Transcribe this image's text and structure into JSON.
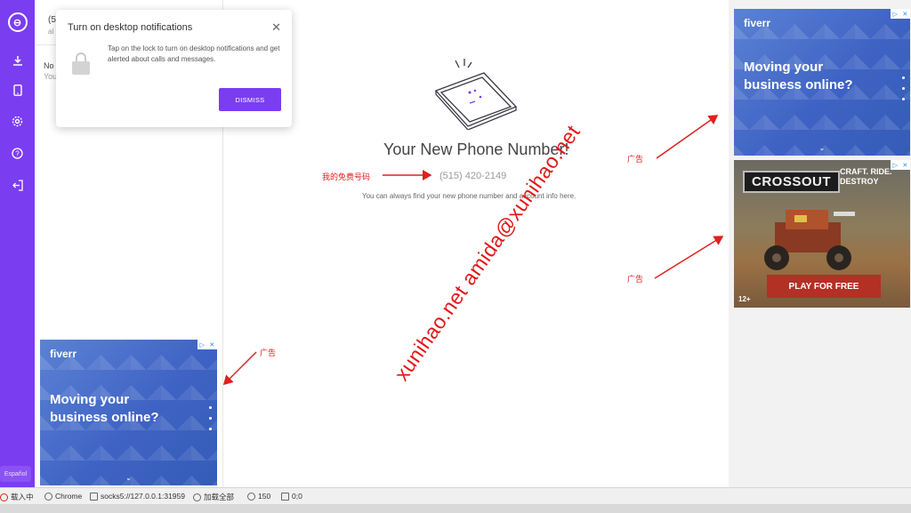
{
  "sidebar": {
    "icons": [
      "logo-icon",
      "download-icon",
      "phone-icon",
      "gear-icon",
      "help-icon",
      "logout-icon"
    ],
    "language": "Español",
    "accent_color": "#7b3df0"
  },
  "panel": {
    "number_partial": "(5",
    "number_sub_partial": "al",
    "no_partial": "No",
    "you_partial": "You"
  },
  "notification": {
    "title": "Turn on desktop notifications",
    "description": "Tap on the lock to turn on desktop notifications and get alerted about calls and messages.",
    "dismiss_label": "DISMISS"
  },
  "main": {
    "title": "Your New Phone Number!",
    "phone_number": "(515) 420-2149",
    "hint": "You can always find your new phone number and account info here."
  },
  "annotations": {
    "my_free_number": "我的免费号码",
    "ad_label": "广告",
    "watermark": "xunihao.net amida@xunihao.net"
  },
  "ads": {
    "fiverr": {
      "brand": "fiverr",
      "headline_line1": "Moving your",
      "headline_line2": "business online?"
    },
    "crossout": {
      "logo": "CROSSOUT",
      "tag_line1": "CRAFT. RIDE.",
      "tag_line2": "DESTROY",
      "cta": "PLAY FOR FREE",
      "age": "12+"
    }
  },
  "statusbar": {
    "loading": "载入中",
    "browser": "Chrome",
    "proxy": "socks5://127.0.0.1:31959",
    "load_all": "加载全部",
    "count": "150",
    "coords": "0;0"
  }
}
